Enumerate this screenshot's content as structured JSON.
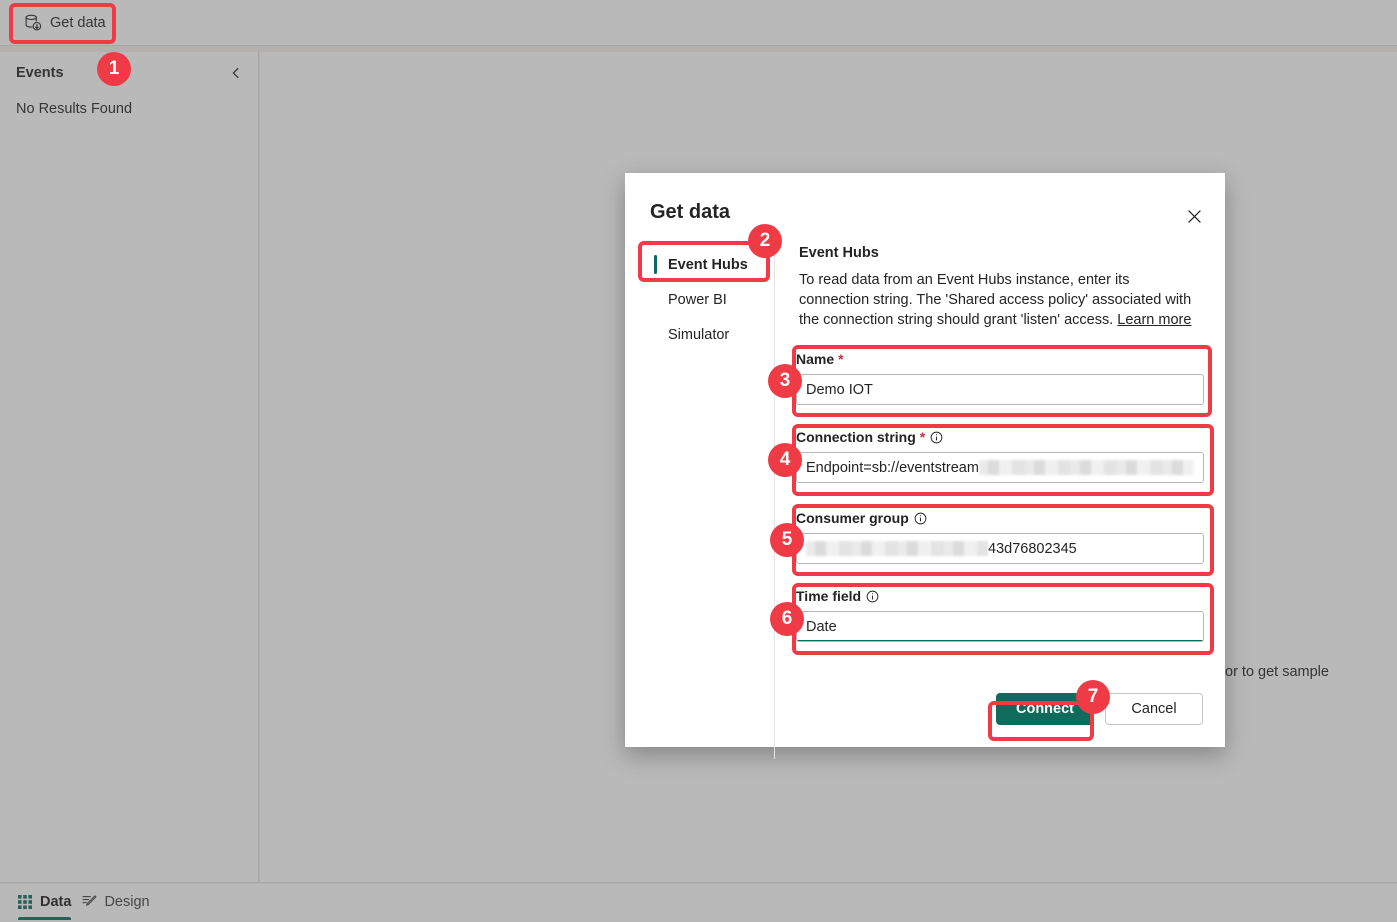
{
  "toolbar": {
    "get_data_label": "Get data",
    "get_data_icon": "database-download-icon"
  },
  "events_panel": {
    "title": "Events",
    "empty_text": "No Results Found",
    "collapse_icon": "chevron-left-icon"
  },
  "canvas": {
    "hint_text": "or to get sample"
  },
  "bottom_tabs": [
    {
      "label": "Data",
      "icon": "grid-icon",
      "active": true
    },
    {
      "label": "Design",
      "icon": "pen-edit-icon",
      "active": false
    }
  ],
  "dialog": {
    "title": "Get data",
    "close_icon": "close-icon",
    "nav": [
      {
        "label": "Event Hubs",
        "selected": true
      },
      {
        "label": "Power BI",
        "selected": false
      },
      {
        "label": "Simulator",
        "selected": false
      }
    ],
    "content": {
      "heading": "Event Hubs",
      "description": "To read data from an Event Hubs instance, enter its connection string. The 'Shared access policy' associated with the connection string should grant 'listen' access. ",
      "learn_more": "Learn more"
    },
    "fields": [
      {
        "label": "Name",
        "required": true,
        "has_info": false,
        "value": "Demo IOT",
        "redacted_before": false,
        "redacted_after": false,
        "focused": false
      },
      {
        "label": "Connection string",
        "required": true,
        "has_info": true,
        "value": "Endpoint=sb://eventstream",
        "redacted_before": false,
        "redacted_after": true,
        "focused": false
      },
      {
        "label": "Consumer group",
        "required": false,
        "has_info": true,
        "value": "43d76802345",
        "redacted_before": true,
        "redacted_after": false,
        "focused": false
      },
      {
        "label": "Time field",
        "required": false,
        "has_info": true,
        "value": "Date",
        "redacted_before": false,
        "redacted_after": false,
        "focused": true
      }
    ],
    "buttons": {
      "connect": "Connect",
      "cancel": "Cancel"
    }
  },
  "annotations": {
    "badges": [
      "1",
      "2",
      "3",
      "4",
      "5",
      "6",
      "7"
    ],
    "color": "#ee3b45"
  },
  "colors": {
    "accent_teal": "#0f6c5c",
    "annotation_red": "#ee3b45",
    "required_star": "#c4314b",
    "overlay": "rgba(80,80,80,0.40)"
  }
}
